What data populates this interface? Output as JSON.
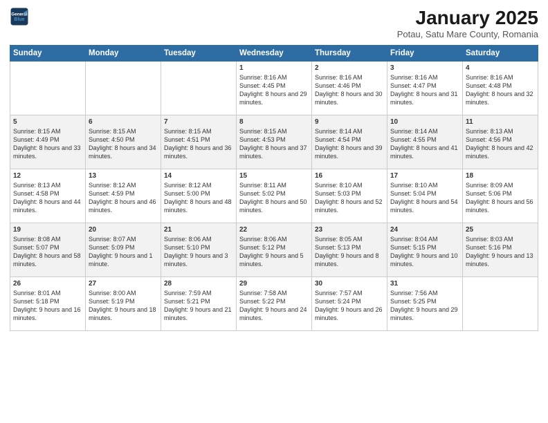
{
  "header": {
    "logo_line1": "General",
    "logo_line2": "Blue",
    "month": "January 2025",
    "location": "Potau, Satu Mare County, Romania"
  },
  "weekdays": [
    "Sunday",
    "Monday",
    "Tuesday",
    "Wednesday",
    "Thursday",
    "Friday",
    "Saturday"
  ],
  "weeks": [
    [
      {
        "day": "",
        "info": ""
      },
      {
        "day": "",
        "info": ""
      },
      {
        "day": "",
        "info": ""
      },
      {
        "day": "1",
        "info": "Sunrise: 8:16 AM\nSunset: 4:45 PM\nDaylight: 8 hours and 29 minutes."
      },
      {
        "day": "2",
        "info": "Sunrise: 8:16 AM\nSunset: 4:46 PM\nDaylight: 8 hours and 30 minutes."
      },
      {
        "day": "3",
        "info": "Sunrise: 8:16 AM\nSunset: 4:47 PM\nDaylight: 8 hours and 31 minutes."
      },
      {
        "day": "4",
        "info": "Sunrise: 8:16 AM\nSunset: 4:48 PM\nDaylight: 8 hours and 32 minutes."
      }
    ],
    [
      {
        "day": "5",
        "info": "Sunrise: 8:15 AM\nSunset: 4:49 PM\nDaylight: 8 hours and 33 minutes."
      },
      {
        "day": "6",
        "info": "Sunrise: 8:15 AM\nSunset: 4:50 PM\nDaylight: 8 hours and 34 minutes."
      },
      {
        "day": "7",
        "info": "Sunrise: 8:15 AM\nSunset: 4:51 PM\nDaylight: 8 hours and 36 minutes."
      },
      {
        "day": "8",
        "info": "Sunrise: 8:15 AM\nSunset: 4:53 PM\nDaylight: 8 hours and 37 minutes."
      },
      {
        "day": "9",
        "info": "Sunrise: 8:14 AM\nSunset: 4:54 PM\nDaylight: 8 hours and 39 minutes."
      },
      {
        "day": "10",
        "info": "Sunrise: 8:14 AM\nSunset: 4:55 PM\nDaylight: 8 hours and 41 minutes."
      },
      {
        "day": "11",
        "info": "Sunrise: 8:13 AM\nSunset: 4:56 PM\nDaylight: 8 hours and 42 minutes."
      }
    ],
    [
      {
        "day": "12",
        "info": "Sunrise: 8:13 AM\nSunset: 4:58 PM\nDaylight: 8 hours and 44 minutes."
      },
      {
        "day": "13",
        "info": "Sunrise: 8:12 AM\nSunset: 4:59 PM\nDaylight: 8 hours and 46 minutes."
      },
      {
        "day": "14",
        "info": "Sunrise: 8:12 AM\nSunset: 5:00 PM\nDaylight: 8 hours and 48 minutes."
      },
      {
        "day": "15",
        "info": "Sunrise: 8:11 AM\nSunset: 5:02 PM\nDaylight: 8 hours and 50 minutes."
      },
      {
        "day": "16",
        "info": "Sunrise: 8:10 AM\nSunset: 5:03 PM\nDaylight: 8 hours and 52 minutes."
      },
      {
        "day": "17",
        "info": "Sunrise: 8:10 AM\nSunset: 5:04 PM\nDaylight: 8 hours and 54 minutes."
      },
      {
        "day": "18",
        "info": "Sunrise: 8:09 AM\nSunset: 5:06 PM\nDaylight: 8 hours and 56 minutes."
      }
    ],
    [
      {
        "day": "19",
        "info": "Sunrise: 8:08 AM\nSunset: 5:07 PM\nDaylight: 8 hours and 58 minutes."
      },
      {
        "day": "20",
        "info": "Sunrise: 8:07 AM\nSunset: 5:09 PM\nDaylight: 9 hours and 1 minute."
      },
      {
        "day": "21",
        "info": "Sunrise: 8:06 AM\nSunset: 5:10 PM\nDaylight: 9 hours and 3 minutes."
      },
      {
        "day": "22",
        "info": "Sunrise: 8:06 AM\nSunset: 5:12 PM\nDaylight: 9 hours and 5 minutes."
      },
      {
        "day": "23",
        "info": "Sunrise: 8:05 AM\nSunset: 5:13 PM\nDaylight: 9 hours and 8 minutes."
      },
      {
        "day": "24",
        "info": "Sunrise: 8:04 AM\nSunset: 5:15 PM\nDaylight: 9 hours and 10 minutes."
      },
      {
        "day": "25",
        "info": "Sunrise: 8:03 AM\nSunset: 5:16 PM\nDaylight: 9 hours and 13 minutes."
      }
    ],
    [
      {
        "day": "26",
        "info": "Sunrise: 8:01 AM\nSunset: 5:18 PM\nDaylight: 9 hours and 16 minutes."
      },
      {
        "day": "27",
        "info": "Sunrise: 8:00 AM\nSunset: 5:19 PM\nDaylight: 9 hours and 18 minutes."
      },
      {
        "day": "28",
        "info": "Sunrise: 7:59 AM\nSunset: 5:21 PM\nDaylight: 9 hours and 21 minutes."
      },
      {
        "day": "29",
        "info": "Sunrise: 7:58 AM\nSunset: 5:22 PM\nDaylight: 9 hours and 24 minutes."
      },
      {
        "day": "30",
        "info": "Sunrise: 7:57 AM\nSunset: 5:24 PM\nDaylight: 9 hours and 26 minutes."
      },
      {
        "day": "31",
        "info": "Sunrise: 7:56 AM\nSunset: 5:25 PM\nDaylight: 9 hours and 29 minutes."
      },
      {
        "day": "",
        "info": ""
      }
    ]
  ]
}
